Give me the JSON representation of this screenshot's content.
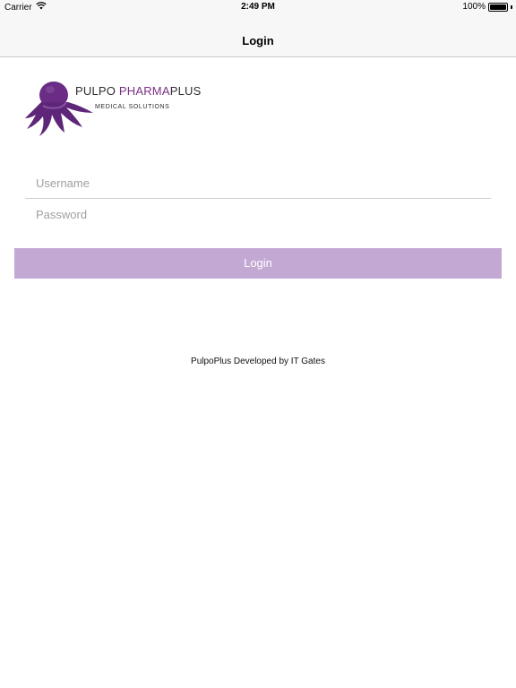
{
  "status_bar": {
    "carrier": "Carrier",
    "time": "2:49 PM",
    "battery": "100%",
    "battery_level": 1.0
  },
  "nav": {
    "title": "Login"
  },
  "logo": {
    "line1_part1": "PULPO ",
    "line1_part2": "PHARMA",
    "line1_part3": "PLUS",
    "line2": "MEDICAL  SOLUTIONS",
    "brand_color": "#7b2f86"
  },
  "form": {
    "username_placeholder": "Username",
    "password_placeholder": "Password",
    "login_label": "Login",
    "button_color": "#c4a8d4"
  },
  "footer": {
    "text": "PulpoPlus Developed by IT Gates"
  }
}
